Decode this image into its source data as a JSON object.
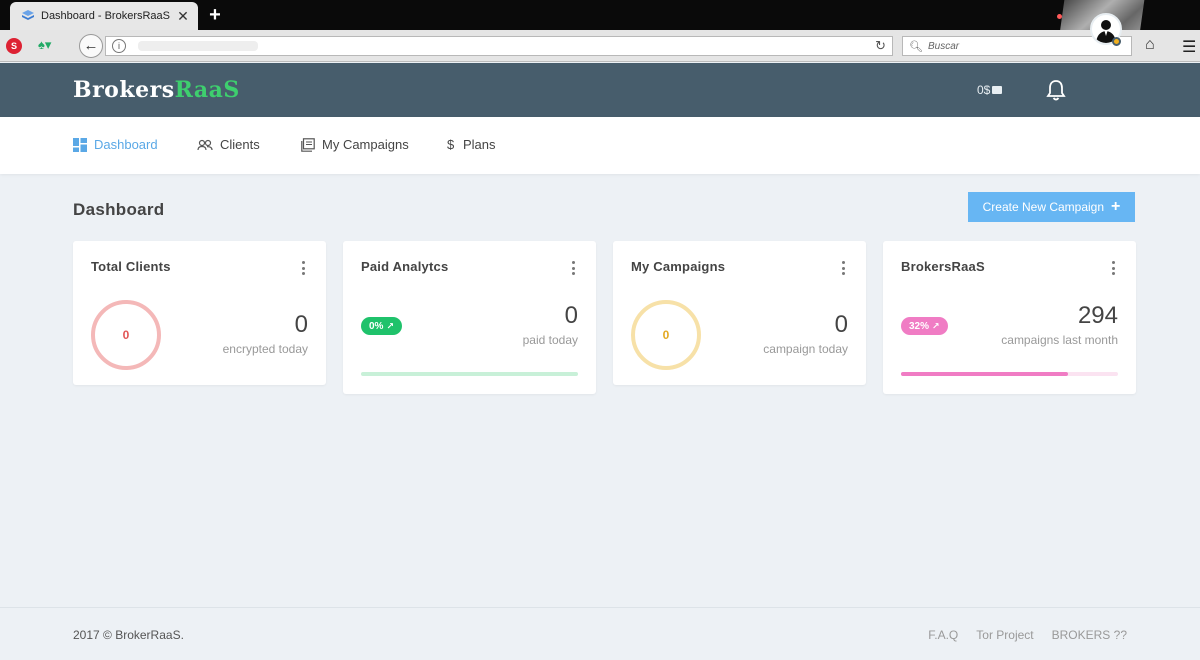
{
  "browser": {
    "tab_title": "Dashboard - BrokersRaaS",
    "search_placeholder": "Buscar"
  },
  "header": {
    "logo_part1": "Brokers",
    "logo_part2": "RaaS",
    "balance": "0$"
  },
  "nav": {
    "items": [
      {
        "label": "Dashboard",
        "icon": "dashboard-icon"
      },
      {
        "label": "Clients",
        "icon": "users-icon"
      },
      {
        "label": "My Campaigns",
        "icon": "campaigns-icon"
      },
      {
        "label": "Plans",
        "icon": "dollar-icon"
      }
    ]
  },
  "page": {
    "title": "Dashboard",
    "create_button": "Create New Campaign"
  },
  "cards": [
    {
      "title": "Total Clients",
      "ring_value": "0",
      "value": "0",
      "caption": "encrypted today",
      "color": "#f2a5a5"
    },
    {
      "title": "Paid Analytcs",
      "badge": "0%",
      "value": "0",
      "caption": "paid today",
      "color": "#1fc26b",
      "progress": 0
    },
    {
      "title": "My Campaigns",
      "ring_value": "0",
      "value": "0",
      "caption": "campaign today",
      "color": "#f7dea0"
    },
    {
      "title": "BrokersRaaS",
      "badge": "32%",
      "value": "294",
      "caption": "campaigns last month",
      "color": "#f07cc4",
      "progress": 0.77
    }
  ],
  "footer": {
    "copyright": "2017 © BrokerRaaS.",
    "links": [
      "F.A.Q",
      "Tor Project",
      "BROKERS ??"
    ]
  }
}
